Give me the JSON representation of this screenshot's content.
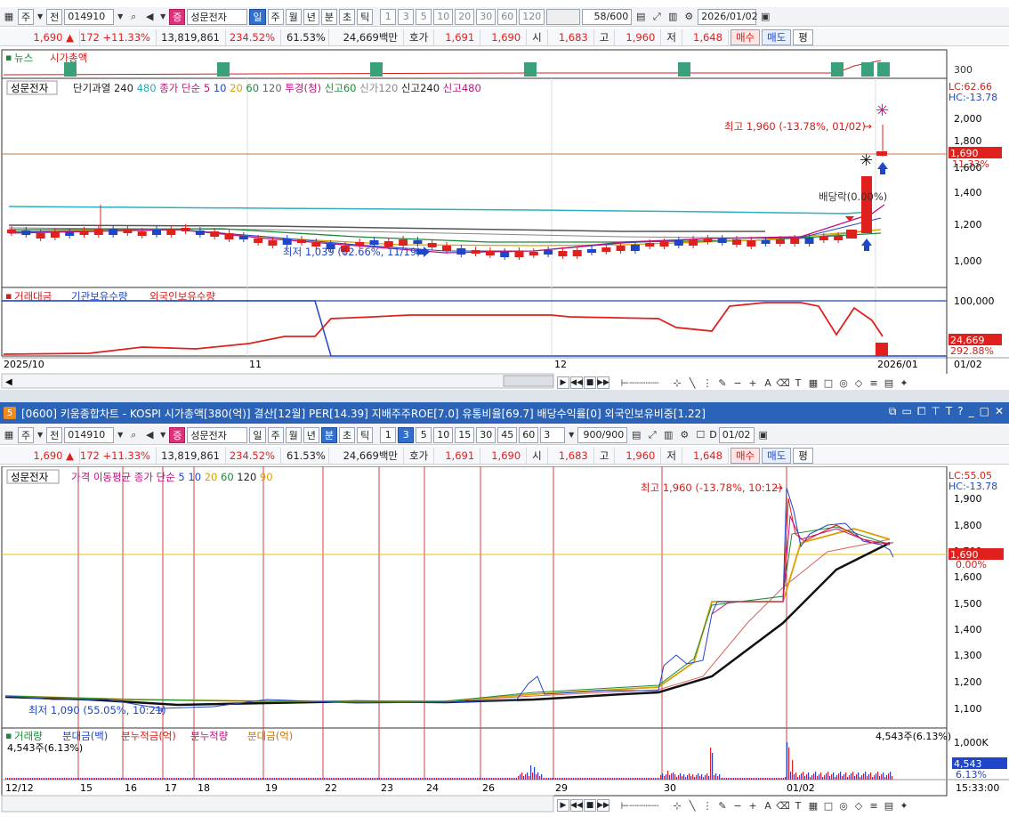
{
  "top": {
    "toolbar": {
      "market": "주",
      "jeon": "전",
      "code": "014910",
      "stock_badge": "증",
      "stock_name": "성문전자",
      "periods": [
        "일",
        "주",
        "월",
        "년",
        "분",
        "초",
        "틱"
      ],
      "active_period": "일",
      "nums": [
        "1",
        "3",
        "5",
        "10",
        "20",
        "30",
        "60",
        "120"
      ],
      "count_value": "58/600",
      "date": "2026/01/02"
    },
    "quote": {
      "price": "1,690",
      "arrow": "▲",
      "change": "172",
      "pct": "+11.33%",
      "volume": "13,819,861",
      "vol_ratio": "234.52%",
      "turnover": "61.53%",
      "amount": "24,669백만",
      "hoga_label": "호가",
      "ask": "1,691",
      "bid": "1,690",
      "open_label": "시",
      "open": "1,683",
      "high_label": "고",
      "high": "1,960",
      "low_label": "저",
      "low": "1,648",
      "buy": "매수",
      "sell": "매도",
      "avg": "평"
    },
    "news": {
      "label1": "뉴스",
      "label2": "시가총액",
      "axis": "300"
    },
    "legend": {
      "name": "성문전자",
      "items": [
        {
          "text": "단기과열",
          "color": "#222222"
        },
        {
          "text": "240",
          "color": "#222222"
        },
        {
          "text": "480",
          "color": "#2aa8b8"
        },
        {
          "text": "종가 단순",
          "color": "#c01080"
        },
        {
          "text": "5",
          "color": "#c01080"
        },
        {
          "text": "10",
          "color": "#1f46c8"
        },
        {
          "text": "20",
          "color": "#d9a000"
        },
        {
          "text": "60",
          "color": "#1a8a3a"
        },
        {
          "text": "120",
          "color": "#666666"
        },
        {
          "text": "투경(청)",
          "color": "#c01080"
        },
        {
          "text": "신고60",
          "color": "#1a8a3a"
        },
        {
          "text": "신가120",
          "color": "#888888"
        },
        {
          "text": "신고240",
          "color": "#222222"
        },
        {
          "text": "신고480",
          "color": "#c01080"
        }
      ]
    },
    "annotations": {
      "high": "최고 1,960 (-13.78%, 01/02)",
      "low": "최저 1,039 (62.66%, 11/19)",
      "dividend": "배당락(0.00%)",
      "lc": "LC:62.66",
      "hc": "HC:-13.78",
      "price_tag": "1,690",
      "pct_tag": "11.33%"
    },
    "y_axis": [
      "2,000",
      "1,800",
      "1,600",
      "1,400",
      "1,200",
      "1,000"
    ],
    "volume_legend": [
      "거래대금",
      "기관보유수량",
      "외국인보유수량"
    ],
    "vol_axis": {
      "top": "100,000",
      "tag1": "24,669",
      "tag2": "292.88%"
    },
    "x_axis": [
      "2025/10",
      "11",
      "12",
      "2026/01",
      "01/02"
    ]
  },
  "bottom": {
    "title": "[0600] 키움종합차트 - KOSPI 시가총액[380(억)] 결산[12월] PER[14.39] 지배주주ROE[7.0] 유통비율[69.7] 배당수익률[0] 외국인보유비중[1.22]",
    "title_num": "5",
    "toolbar": {
      "market": "주",
      "jeon": "전",
      "code": "014910",
      "stock_badge": "증",
      "stock_name": "성문전자",
      "periods": [
        "일",
        "주",
        "월",
        "년",
        "분",
        "초",
        "틱"
      ],
      "active_period": "분",
      "nums": [
        "1",
        "3",
        "5",
        "10",
        "15",
        "30",
        "45",
        "60"
      ],
      "active_num": "3",
      "select": "3",
      "count_value": "900/900",
      "checkbox_label": "D",
      "date": "01/02"
    },
    "legend": {
      "name": "성문전자",
      "items": [
        {
          "text": "가격 이동평균",
          "color": "#c01080"
        },
        {
          "text": "종가 단순",
          "color": "#c01080"
        },
        {
          "text": "5",
          "color": "#1f46c8"
        },
        {
          "text": "10",
          "color": "#1f46c8"
        },
        {
          "text": "20",
          "color": "#d9a000"
        },
        {
          "text": "60",
          "color": "#1a8a3a"
        },
        {
          "text": "120",
          "color": "#222222"
        },
        {
          "text": "90",
          "color": "#d9a000"
        }
      ]
    },
    "annotations": {
      "high": "최고 1,960 (-13.78%, 10:12)",
      "low": "최저 1,090 (55.05%, 10:21)",
      "lc": "LC:55.05",
      "hc": "HC:-13.78",
      "price_tag": "1,690",
      "pct_tag": "0.00%"
    },
    "y_axis": [
      "1,900",
      "1,800",
      "1,700",
      "1,600",
      "1,500",
      "1,400",
      "1,300",
      "1,200",
      "1,100"
    ],
    "volume_legend": [
      "거래량",
      "분대금(백)",
      "분누적금(억)",
      "분누적량",
      "분대금(억)"
    ],
    "vol_label_left": "4,543주(6.13%)",
    "vol_label_right": "4,543주(6.13%)",
    "vol_axis": {
      "top": "1,000K",
      "tag1": "4,543",
      "tag2": "6.13%"
    },
    "x_axis": [
      "12/12",
      "15",
      "16",
      "17",
      "18",
      "19",
      "22",
      "23",
      "24",
      "26",
      "29",
      "30",
      "01/02"
    ],
    "time": "15:33:00"
  }
}
